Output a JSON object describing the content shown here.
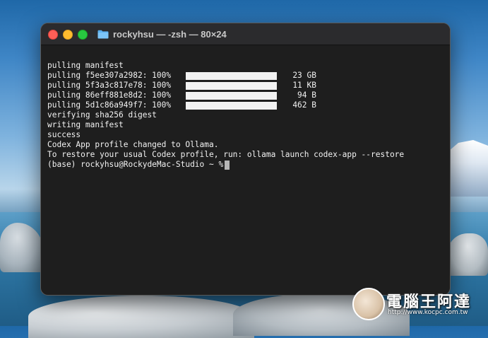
{
  "window": {
    "title": "rockyhsu — -zsh — 80×24",
    "title_icon": "folder-icon"
  },
  "terminal": {
    "line_manifest": "pulling manifest",
    "pulls": [
      {
        "label": "pulling f5ee307a2982: 100%",
        "progress": 1.0,
        "size": "23 GB"
      },
      {
        "label": "pulling 5f3a3c817e78: 100%",
        "progress": 1.0,
        "size": "11 KB"
      },
      {
        "label": "pulling 86eff881e8d2: 100%",
        "progress": 1.0,
        "size": "94 B"
      },
      {
        "label": "pulling 5d1c86a949f7: 100%",
        "progress": 1.0,
        "size": "462 B"
      }
    ],
    "line_verify": "verifying sha256 digest",
    "line_write": "writing manifest",
    "line_success": "success",
    "line_profile": "Codex App profile changed to Ollama.",
    "line_restore": "To restore your usual Codex profile, run: ollama launch codex-app --restore",
    "prompt": "(base) rockyhsu@RockydeMac-Studio ~ %"
  },
  "watermark": {
    "text": "電腦王阿達",
    "url": "http://www.kocpc.com.tw"
  },
  "colors": {
    "terminal_bg": "#1e1e1e",
    "text": "#f2f2f2",
    "close": "#ff5f57",
    "minimize": "#febc2e",
    "maximize": "#28c840",
    "folder": "#5ab0f0"
  }
}
